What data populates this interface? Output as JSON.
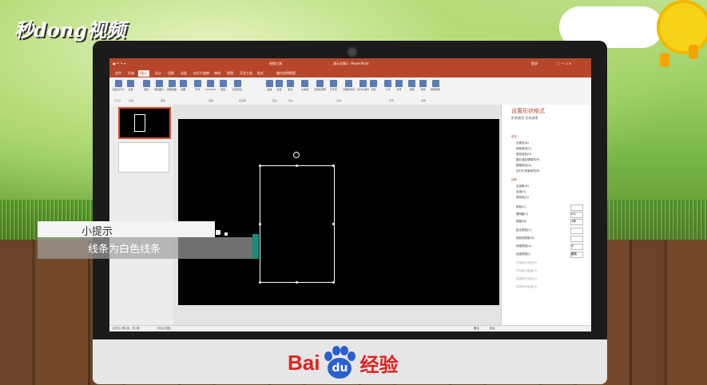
{
  "watermark": {
    "top_logo": "秒dong视频"
  },
  "brand": {
    "baidu_b": "Bai",
    "baidu_paw": "du",
    "baidu_cn": "经验"
  },
  "app": {
    "titlebar": {
      "left": "绘图工具",
      "center": "演示文稿1 - PowerPoint",
      "right": "登录"
    },
    "tabs": [
      "文件",
      "开始",
      "插入",
      "设计",
      "切换",
      "动画",
      "幻灯片放映",
      "审阅",
      "视图",
      "开发工具",
      "格式",
      "操作说明搜索"
    ],
    "ribbon": {
      "buttons": [
        "新建幻灯片",
        "表格",
        "图片",
        "联机图片",
        "屏幕截图",
        "相册",
        "形状",
        "SmartArt",
        "图表",
        "应用商店",
        "我的加载项",
        "缩放",
        "链接",
        "动作",
        "批注",
        "文本框",
        "页眉和页脚",
        "艺术字",
        "日期和时间",
        "幻灯片编号",
        "对象",
        "公式",
        "符号",
        "视频",
        "音频",
        "屏幕录制"
      ],
      "groups": [
        "幻灯片",
        "表格",
        "图像",
        "插图",
        "加载项",
        "链接",
        "批注",
        "文本",
        "符号",
        "媒体"
      ]
    },
    "format_pane": {
      "title": "设置形状格式",
      "tabs": "形状选项  文本选项",
      "fill_section": "填充",
      "fill_options": [
        "无填充(N)",
        "纯色填充(S)",
        "渐变填充(G)",
        "图片或纹理填充(P)",
        "图案填充(A)",
        "幻灯片背景填充(B)"
      ],
      "line_section": "线条",
      "line_options": [
        "无线条(N)",
        "实线(S)",
        "渐变线(G)"
      ],
      "properties": [
        "颜色(C)",
        "透明度(T)",
        "宽度(W)",
        "复合类型(C)",
        "短划线类型(D)",
        "线端类型(A)",
        "连接类型(J)",
        "开始箭头类型(B)",
        "开始箭头粗细(S)",
        "结尾箭头类型(E)",
        "结尾箭头粗细(N)"
      ],
      "values": [
        "",
        "0%",
        "1磅",
        "",
        "",
        "平",
        "圆角",
        "",
        "",
        "",
        ""
      ]
    },
    "status": {
      "slide": "幻灯片 第1张，共1张",
      "lang": "中文(中国)",
      "notes": "备注",
      "comments": "批注"
    }
  },
  "tip": {
    "title": "小提示",
    "body": "线条为白色线条"
  }
}
